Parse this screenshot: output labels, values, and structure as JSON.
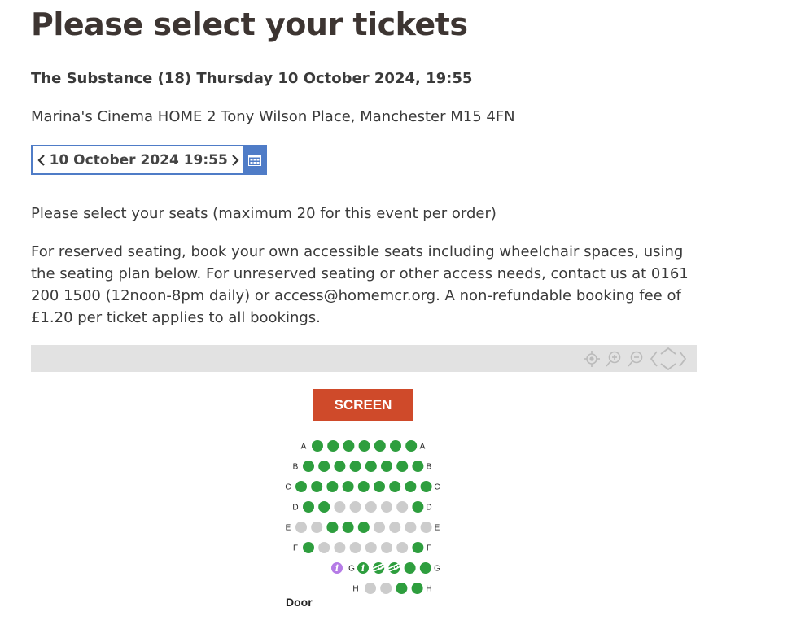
{
  "page": {
    "title": "Please select your tickets",
    "event_title": "The Substance (18) Thursday 10 October 2024, 19:55",
    "venue": "Marina's Cinema HOME 2 Tony Wilson Place, Manchester M15 4FN",
    "seat_instructions": "Please select your seats (maximum 20 for this event per order)",
    "access_text": "For reserved seating, book your own accessible seats including wheelchair spaces, using the seating plan below. For unreserved seating or other access needs, contact us at 0161 200 1500 (12noon-8pm daily) or access@homemcr.org. A non-refundable booking fee of £1.20 per ticket applies to all bookings."
  },
  "date_picker": {
    "label": "10 October 2024 19:55",
    "prev_icon": "chevron-left-icon",
    "next_icon": "chevron-right-icon",
    "calendar_icon": "calendar-icon"
  },
  "toolbar": {
    "icons": [
      "recenter-icon",
      "zoom-in-icon",
      "zoom-out-icon",
      "pan-left-icon",
      "pan-up-down-icon",
      "pan-right-icon"
    ]
  },
  "seatmap": {
    "screen_label": "SCREEN",
    "door_label": "Door",
    "colors": {
      "available": "#2e9e3e",
      "unavailable": "#cccccc",
      "info": "#b57be6",
      "screen": "#cf4a2a",
      "accent": "#4f7cc7"
    },
    "legend": {
      "a": "available",
      "u": "unavailable",
      "i": "info",
      "ai": "available with info icon",
      "w": "wheelchair space (available)"
    },
    "rows": [
      {
        "label": "A",
        "seats": [
          "a",
          "a",
          "a",
          "a",
          "a",
          "a",
          "a"
        ]
      },
      {
        "label": "B",
        "seats": [
          "a",
          "a",
          "a",
          "a",
          "a",
          "a",
          "a",
          "a"
        ]
      },
      {
        "label": "C",
        "seats": [
          "a",
          "a",
          "a",
          "a",
          "a",
          "a",
          "a",
          "a",
          "a"
        ]
      },
      {
        "label": "D",
        "seats": [
          "a",
          "a",
          "u",
          "u",
          "u",
          "u",
          "u",
          "a"
        ]
      },
      {
        "label": "E",
        "seats": [
          "u",
          "u",
          "a",
          "a",
          "a",
          "u",
          "u",
          "u",
          "u"
        ]
      },
      {
        "label": "F",
        "seats": [
          "a",
          "u",
          "u",
          "u",
          "u",
          "u",
          "u",
          "a"
        ]
      },
      {
        "label": "G",
        "seats": [
          "ai",
          "w",
          "w",
          "a",
          "a"
        ],
        "pre_icon": "i"
      },
      {
        "label": "H",
        "seats": [
          "u",
          "u",
          "a",
          "a"
        ]
      }
    ]
  }
}
